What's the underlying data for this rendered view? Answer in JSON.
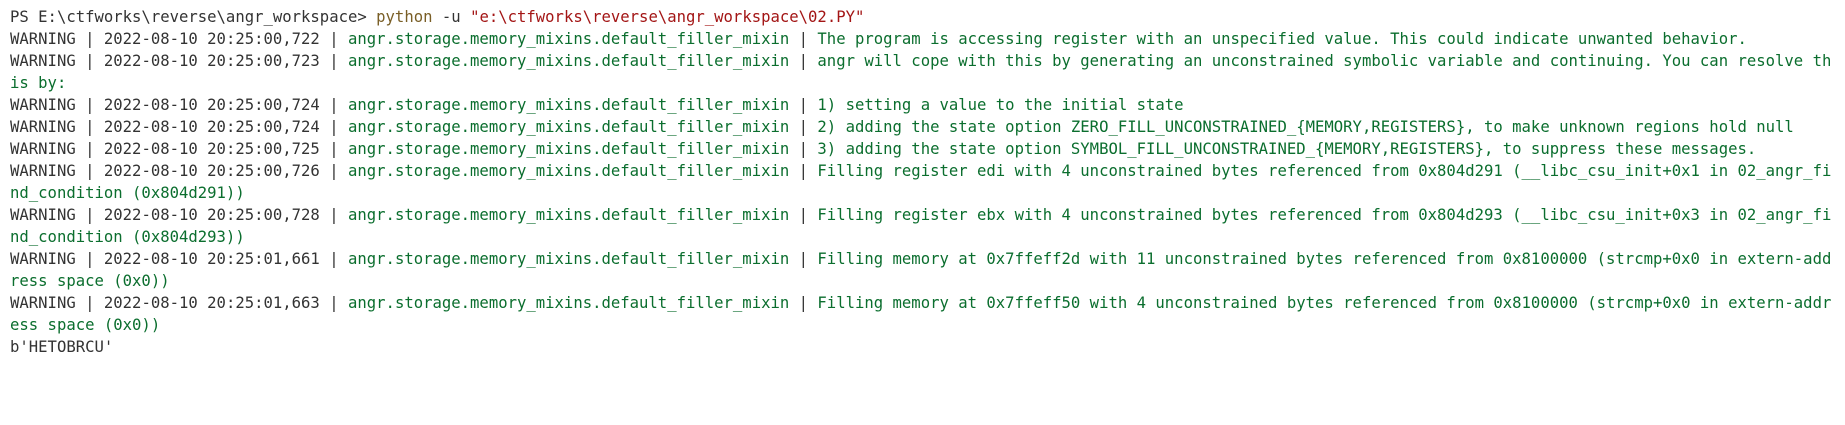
{
  "terminal": {
    "prompt": "PS E:\\ctfworks\\reverse\\angr_workspace>",
    "command": "python",
    "flag": "-u",
    "script_path": "\"e:\\ctfworks\\reverse\\angr_workspace\\02.PY\"",
    "separator": "|",
    "logs": [
      {
        "level": "WARNING",
        "timestamp": "2022-08-10 20:25:00,722",
        "module": "angr.storage.memory_mixins.default_filler_mixin",
        "message": "The program is accessing register with an unspecified value. This could indicate unwanted behavior."
      },
      {
        "level": "WARNING",
        "timestamp": "2022-08-10 20:25:00,723",
        "module": "angr.storage.memory_mixins.default_filler_mixin",
        "message": "angr will cope with this by generating an unconstrained symbolic variable and continuing. You can resolve this by:"
      },
      {
        "level": "WARNING",
        "timestamp": "2022-08-10 20:25:00,724",
        "module": "angr.storage.memory_mixins.default_filler_mixin",
        "message": "1) setting a value to the initial state"
      },
      {
        "level": "WARNING",
        "timestamp": "2022-08-10 20:25:00,724",
        "module": "angr.storage.memory_mixins.default_filler_mixin",
        "message": "2) adding the state option ZERO_FILL_UNCONSTRAINED_{MEMORY,REGISTERS}, to make unknown regions hold null"
      },
      {
        "level": "WARNING",
        "timestamp": "2022-08-10 20:25:00,725",
        "module": "angr.storage.memory_mixins.default_filler_mixin",
        "message": "3) adding the state option SYMBOL_FILL_UNCONSTRAINED_{MEMORY,REGISTERS}, to suppress these messages."
      },
      {
        "level": "WARNING",
        "timestamp": "2022-08-10 20:25:00,726",
        "module": "angr.storage.memory_mixins.default_filler_mixin",
        "message": "Filling register edi with 4 unconstrained bytes referenced from 0x804d291 (__libc_csu_init+0x1 in 02_angr_find_condition (0x804d291))"
      },
      {
        "level": "WARNING",
        "timestamp": "2022-08-10 20:25:00,728",
        "module": "angr.storage.memory_mixins.default_filler_mixin",
        "message": "Filling register ebx with 4 unconstrained bytes referenced from 0x804d293 (__libc_csu_init+0x3 in 02_angr_find_condition (0x804d293))"
      },
      {
        "level": "WARNING",
        "timestamp": "2022-08-10 20:25:01,661",
        "module": "angr.storage.memory_mixins.default_filler_mixin",
        "message": "Filling memory at 0x7ffeff2d with 11 unconstrained bytes referenced from 0x8100000 (strcmp+0x0 in extern-address space (0x0))"
      },
      {
        "level": "WARNING",
        "timestamp": "2022-08-10 20:25:01,663",
        "module": "angr.storage.memory_mixins.default_filler_mixin",
        "message": "Filling memory at 0x7ffeff50 with 4 unconstrained bytes referenced from 0x8100000 (strcmp+0x0 in extern-address space (0x0))"
      }
    ],
    "output": "b'HETOBRCU'"
  }
}
